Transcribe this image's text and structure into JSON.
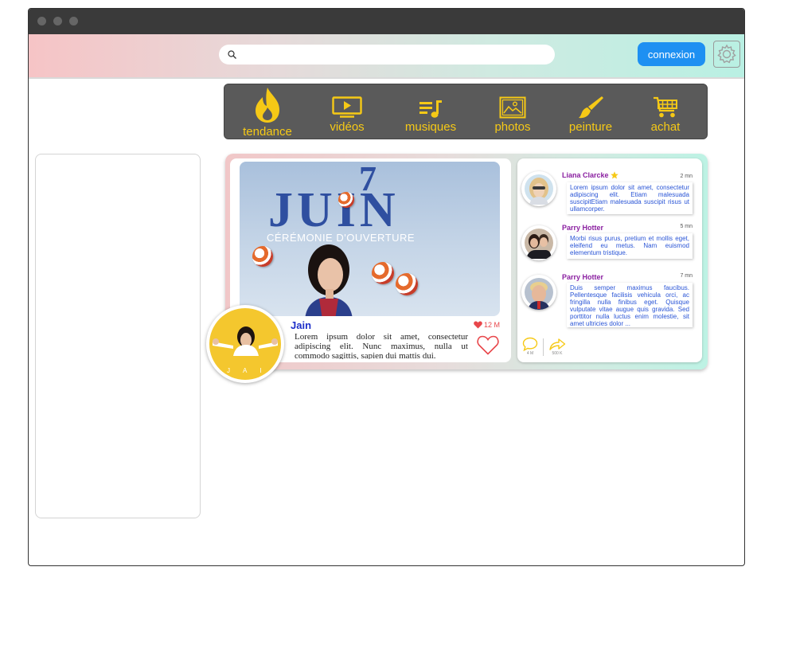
{
  "header": {
    "search_placeholder": "",
    "login_label": "connexion"
  },
  "nav": {
    "items": [
      {
        "label": "tendance",
        "icon": "flame-icon"
      },
      {
        "label": "vidéos",
        "icon": "video-player-icon"
      },
      {
        "label": "musiques",
        "icon": "music-playlist-icon"
      },
      {
        "label": "photos",
        "icon": "image-icon"
      },
      {
        "label": "peinture",
        "icon": "paintbrush-icon"
      },
      {
        "label": "achat",
        "icon": "shopping-cart-icon"
      }
    ]
  },
  "post": {
    "hero_number": "7",
    "hero_title": "JUIN",
    "hero_subtitle": "CÉRÉMONIE D'OUVERTURE",
    "author": "Jain",
    "avatar_caption": "JAI",
    "likes": "12 M",
    "text": "Lorem ipsum dolor sit amet, consectetur adipiscing elit. Nunc maximus, nulla ut commodo sagittis, sapien dui mattis dui."
  },
  "comments": [
    {
      "name": "Liana Clarcke",
      "time": "2 mn",
      "text": "Lorem ipsum dolor sit amet, consectetur adipiscing elit. Etiam malesuada suscipitEtiam malesuada suscipit risus ut ullamcorper."
    },
    {
      "name": "Parry Hotter",
      "time": "5 mn",
      "text": "Morbi risus purus, pretium et mollis eget, eleifend eu metus. Nam euismod elementum tristique."
    },
    {
      "name": "Parry Hotter",
      "time": "7 mn",
      "text": "Duis semper maximus faucibus. Pellentesque facilisis vehicula orci, ac fringilla nulla finibus eget. Quisque vulputate vitae augue quis gravida. Sed porttitor nulla luctus enim molestie, sit amet ultricies dolor ..."
    }
  ],
  "comment_actions": {
    "comments_count": "4 M",
    "shares_count": "500 K"
  },
  "colors": {
    "accent_yellow": "#f6c916",
    "login_blue": "#1e90f2",
    "nav_bg": "#5a5a5a",
    "name_purple": "#8a1fa0",
    "comment_blue": "#2a55d6"
  }
}
